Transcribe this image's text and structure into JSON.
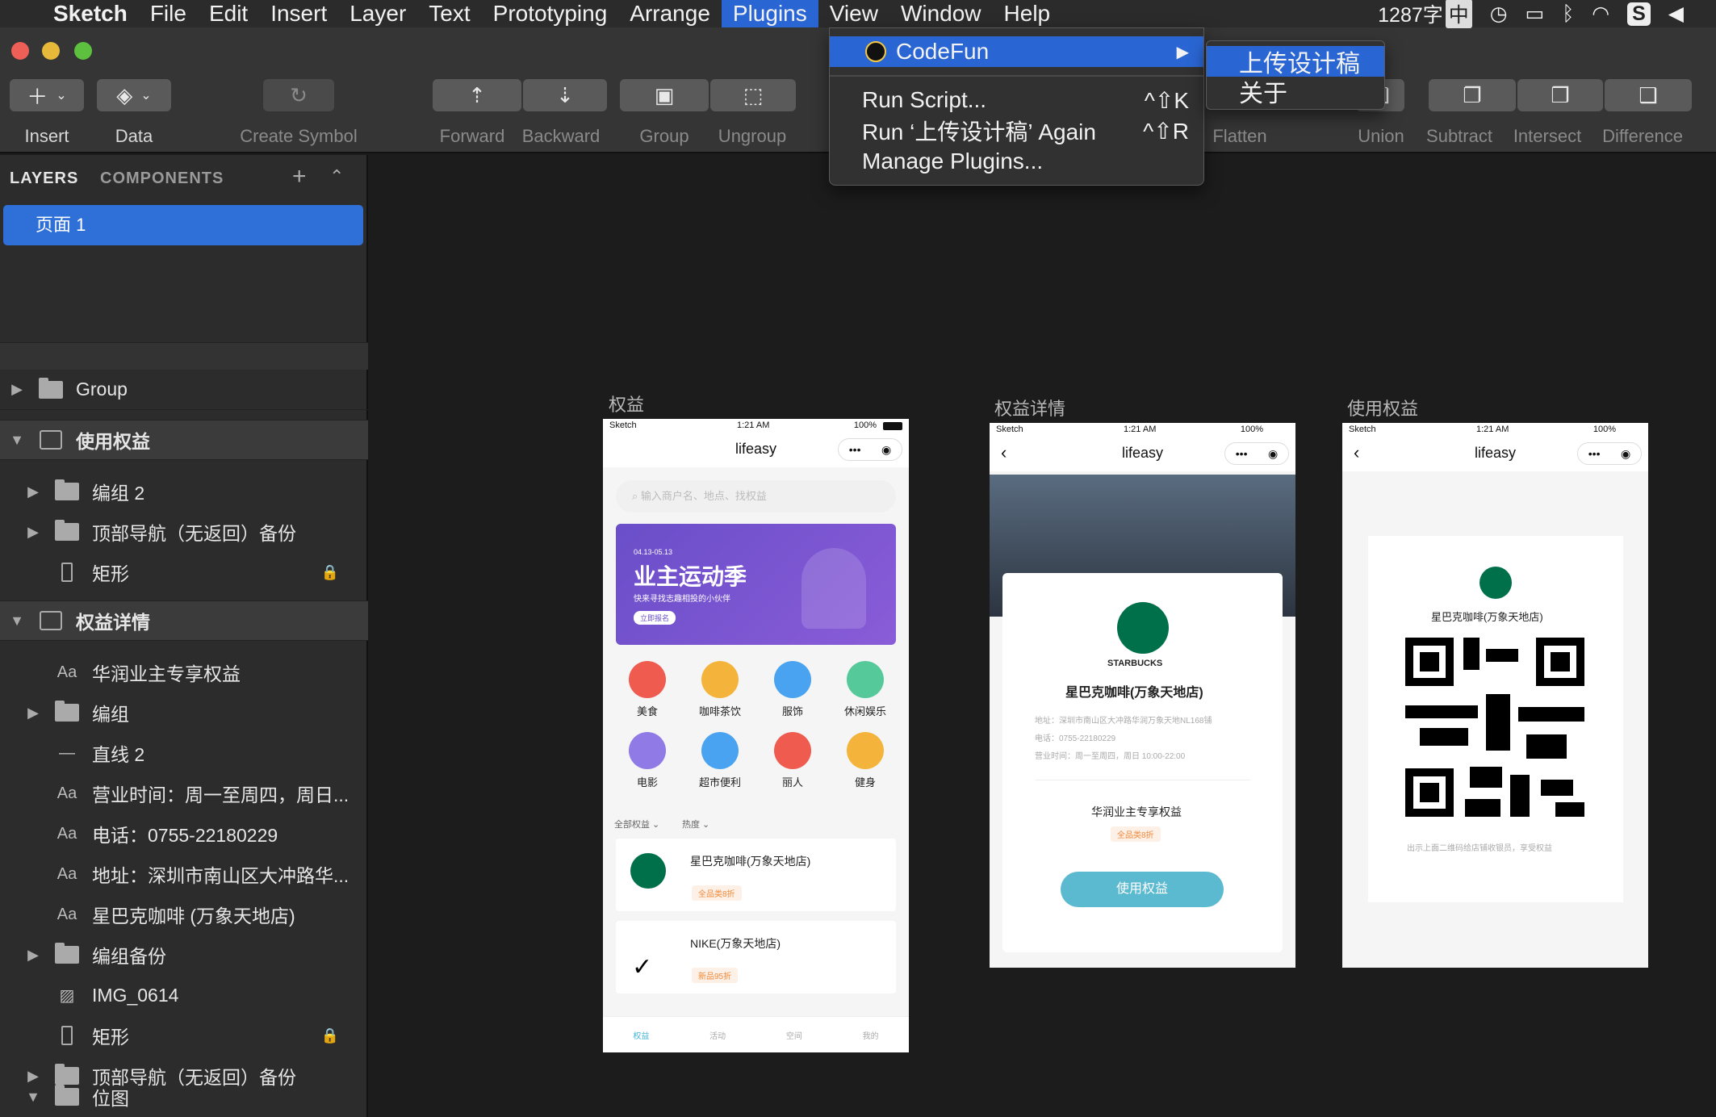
{
  "menubar": {
    "app": "Sketch",
    "items": [
      "File",
      "Edit",
      "Insert",
      "Layer",
      "Text",
      "Prototyping",
      "Arrange",
      "Plugins",
      "View",
      "Window",
      "Help"
    ],
    "active": "Plugins",
    "status_count": "1287字",
    "status_ime": "中"
  },
  "toolbar": {
    "insert": "Insert",
    "data": "Data",
    "create_symbol": "Create Symbol",
    "forward": "Forward",
    "backward": "Backward",
    "group": "Group",
    "ungroup": "Ungroup",
    "flatten": "Flatten",
    "union": "Union",
    "subtract": "Subtract",
    "intersect": "Intersect",
    "difference": "Difference"
  },
  "plugins_menu": {
    "codefun": "CodeFun",
    "run_script": "Run Script...",
    "run_script_shortcut": "^⇧K",
    "run_again": "Run ‘上传设计稿’ Again",
    "run_again_shortcut": "^⇧R",
    "manage": "Manage Plugins..."
  },
  "submenu": {
    "upload": "上传设计稿",
    "about": "关于"
  },
  "sidebar": {
    "tab_layers": "LAYERS",
    "tab_components": "COMPONENTS",
    "page": "页面 1",
    "layers": [
      {
        "label": "Group"
      },
      {
        "label": "使用权益"
      },
      {
        "label": "编组 2"
      },
      {
        "label": "顶部导航（无返回）备份"
      },
      {
        "label": "矩形"
      },
      {
        "label": "权益详情"
      },
      {
        "label": "华润业主专享权益"
      },
      {
        "label": "编组"
      },
      {
        "label": "直线 2"
      },
      {
        "label": "营业时间：周一至周四，周日..."
      },
      {
        "label": "电话：0755-22180229"
      },
      {
        "label": "地址：深圳市南山区大冲路华..."
      },
      {
        "label": "星巴克咖啡 (万象天地店)"
      },
      {
        "label": "编组备份"
      },
      {
        "label": "IMG_0614"
      },
      {
        "label": "矩形"
      },
      {
        "label": "顶部导航（无返回）备份"
      },
      {
        "label": "位图"
      }
    ]
  },
  "artboards": {
    "a1_label": "权益",
    "a2_label": "权益详情",
    "a3_label": "使用权益",
    "status_carrier": "Sketch",
    "status_time": "1:21 AM",
    "status_batt": "100%",
    "nav_title": "lifeasy",
    "search_placeholder": "输入商户名、地点、找权益",
    "banner_date": "04.13-05.13",
    "banner_title": "业主运动季",
    "banner_sub": "快来寻找志趣相投的小伙伴",
    "banner_btn": "立即报名",
    "categories": [
      "美食",
      "咖啡茶饮",
      "服饰",
      "休闲娱乐",
      "电影",
      "超市便利",
      "丽人",
      "健身"
    ],
    "filter_all": "全部权益",
    "filter_hot": "热度",
    "card1_title": "星巴克咖啡(万象天地店)",
    "card1_tag": "全品类8折",
    "card2_title": "NIKE(万象天地店)",
    "card2_tag": "新品95折",
    "tabs": [
      "权益",
      "活动",
      "空间",
      "我的"
    ],
    "detail_brand": "STARBUCKS",
    "detail_name": "星巴克咖啡(万象天地店)",
    "detail_addr": "地址：深圳市南山区大冲路华润万象天地NL168铺",
    "detail_phone": "电话：0755-22180229",
    "detail_hours": "营业时间：周一至周四，周日 10:00-22:00",
    "detail_benefit": "华润业主专享权益",
    "detail_tag": "全品类8折",
    "detail_btn": "使用权益",
    "use_name": "星巴克咖啡(万象天地店)",
    "use_hint": "出示上面二维码给店铺收银员，享受权益"
  },
  "colors": {
    "accent": "#2a66d3",
    "banner": "#6a4ec9",
    "button": "#5bb9d0",
    "starbucks": "#00704a"
  }
}
